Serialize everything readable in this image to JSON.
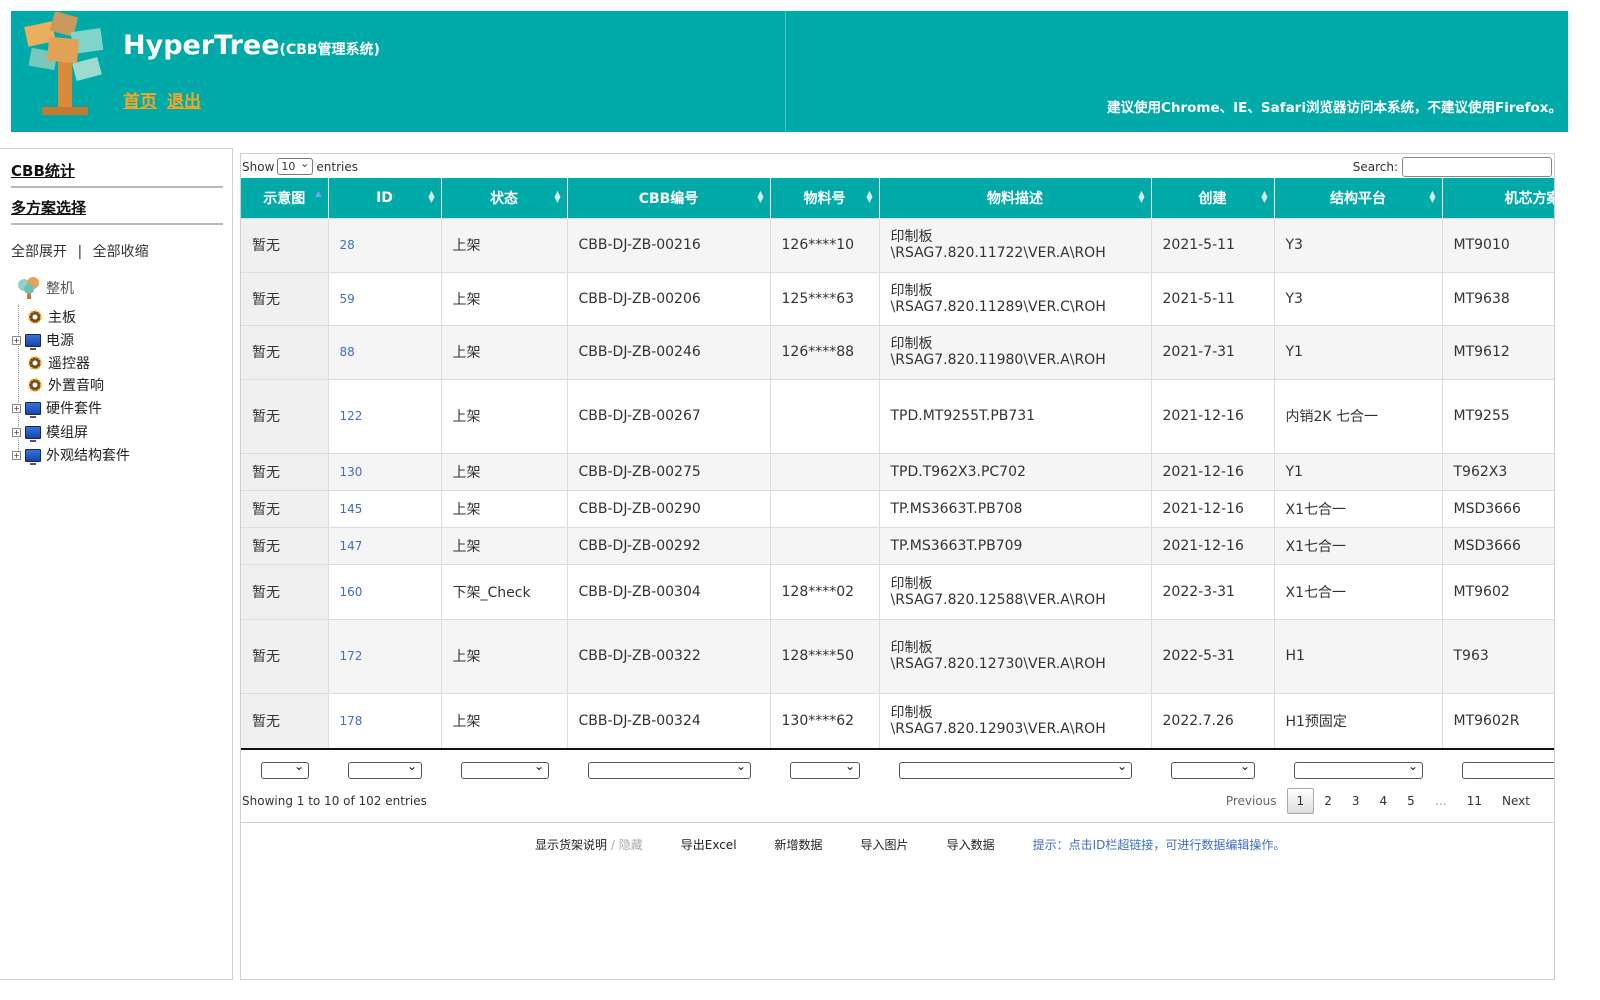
{
  "header": {
    "title": "HyperTree",
    "subtitle": "(CBB管理系统)",
    "nav": [
      "首页",
      "退出"
    ],
    "browser_tip": "建议使用Chrome、IE、Safari浏览器访问本系统，不建议使用Firefox。",
    "brand_color": "#00aaa8",
    "nav_color": "#f6a623"
  },
  "sidebar": {
    "link_stats": "CBB统计",
    "link_multi": "多方案选择",
    "expand_all": "全部展开",
    "sep": "|",
    "collapse_all": "全部收缩",
    "tree": {
      "root": "整机",
      "nodes": [
        {
          "label": "主板",
          "icon": "gear-icon",
          "expandable": false
        },
        {
          "label": "电源",
          "icon": "computer-icon",
          "expandable": true
        },
        {
          "label": "遥控器",
          "icon": "gear-icon",
          "expandable": false
        },
        {
          "label": "外置音响",
          "icon": "gear-icon",
          "expandable": false
        },
        {
          "label": "硬件套件",
          "icon": "computer-icon",
          "expandable": true
        },
        {
          "label": "模组屏",
          "icon": "computer-icon",
          "expandable": true
        },
        {
          "label": "外观结构套件",
          "icon": "computer-icon",
          "expandable": true
        }
      ]
    }
  },
  "table_controls": {
    "show_label": "Show",
    "page_size": "10",
    "entries_label": "entries",
    "search_label": "Search:"
  },
  "columns": [
    "示意图",
    "ID",
    "状态",
    "CBB编号",
    "物料号",
    "物料描述",
    "创建",
    "结构平台",
    "机芯方案"
  ],
  "rows": [
    {
      "img": "暂无",
      "id": "28",
      "status": "上架",
      "cbb": "CBB-DJ-ZB-00216",
      "mat": "126****10",
      "desc1": "印制板",
      "desc2": "\\RSAG7.820.11722\\VER.A\\ROH",
      "created": "2021-5-11",
      "platform": "Y3",
      "chip": "MT9010"
    },
    {
      "img": "暂无",
      "id": "59",
      "status": "上架",
      "cbb": "CBB-DJ-ZB-00206",
      "mat": "125****63",
      "desc1": "印制板",
      "desc2": "\\RSAG7.820.11289\\VER.C\\ROH",
      "created": "2021-5-11",
      "platform": "Y3",
      "chip": "MT9638"
    },
    {
      "img": "暂无",
      "id": "88",
      "status": "上架",
      "cbb": "CBB-DJ-ZB-00246",
      "mat": "126****88",
      "desc1": "印制板",
      "desc2": "\\RSAG7.820.11980\\VER.A\\ROH",
      "created": "2021-7-31",
      "platform": "Y1",
      "chip": "MT9612"
    },
    {
      "img": "暂无",
      "id": "122",
      "status": "上架",
      "cbb": "CBB-DJ-ZB-00267",
      "mat": "",
      "desc1": "TPD.MT9255T.PB731",
      "desc2": "",
      "created": "2021-12-16",
      "platform": "内销2K 七合一",
      "chip": "MT9255"
    },
    {
      "img": "暂无",
      "id": "130",
      "status": "上架",
      "cbb": "CBB-DJ-ZB-00275",
      "mat": "",
      "desc1": "TPD.T962X3.PC702",
      "desc2": "",
      "created": "2021-12-16",
      "platform": "Y1",
      "chip": "T962X3"
    },
    {
      "img": "暂无",
      "id": "145",
      "status": "上架",
      "cbb": "CBB-DJ-ZB-00290",
      "mat": "",
      "desc1": "TP.MS3663T.PB708",
      "desc2": "",
      "created": "2021-12-16",
      "platform": "X1七合一",
      "chip": "MSD3666"
    },
    {
      "img": "暂无",
      "id": "147",
      "status": "上架",
      "cbb": "CBB-DJ-ZB-00292",
      "mat": "",
      "desc1": "TP.MS3663T.PB709",
      "desc2": "",
      "created": "2021-12-16",
      "platform": "X1七合一",
      "chip": "MSD3666"
    },
    {
      "img": "暂无",
      "id": "160",
      "status": "下架_Check",
      "cbb": "CBB-DJ-ZB-00304",
      "mat": "128****02",
      "desc1": "印制板",
      "desc2": "\\RSAG7.820.12588\\VER.A\\ROH",
      "created": "2022-3-31",
      "platform": "X1七合一",
      "chip": "MT9602"
    },
    {
      "img": "暂无",
      "id": "172",
      "status": "上架",
      "cbb": "CBB-DJ-ZB-00322",
      "mat": "128****50",
      "desc1": "印制板",
      "desc2": "\\RSAG7.820.12730\\VER.A\\ROH",
      "created": "2022-5-31",
      "platform": "H1",
      "chip": "T963"
    },
    {
      "img": "暂无",
      "id": "178",
      "status": "上架",
      "cbb": "CBB-DJ-ZB-00324",
      "mat": "130****62",
      "desc1": "印制板",
      "desc2": "\\RSAG7.820.12903\\VER.A\\ROH",
      "created": "2022.7.26",
      "platform": "H1预固定",
      "chip": "MT9602R"
    }
  ],
  "footer": {
    "info": "Showing 1 to 10 of 102 entries",
    "pager": [
      "Previous",
      "1",
      "2",
      "3",
      "4",
      "5",
      "…",
      "11",
      "Next"
    ],
    "current_page": "1"
  },
  "actions": {
    "show_notes": "显示货架说明",
    "slash": "/",
    "hide": "隐藏",
    "export_excel": "导出Excel",
    "add_data": "新增数据",
    "import_images": "导入图片",
    "import_data": "导入数据",
    "tip": "提示：点击ID栏超链接，可进行数据编辑操作。"
  }
}
